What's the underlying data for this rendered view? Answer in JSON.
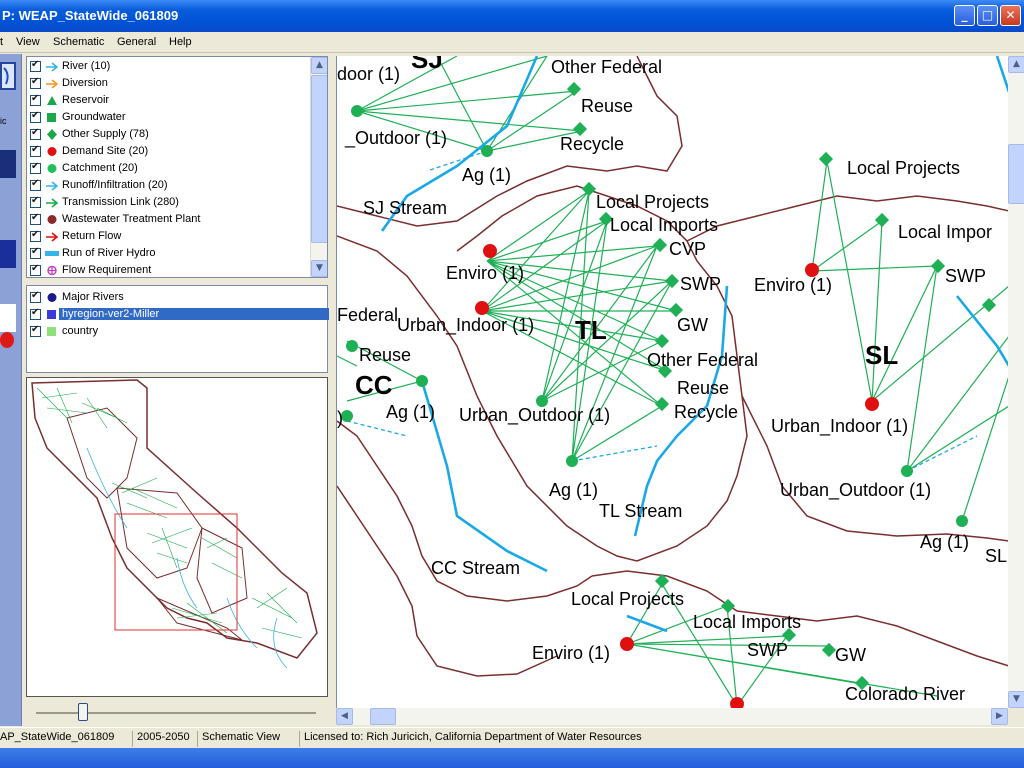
{
  "window": {
    "title": "P: WEAP_StateWide_061809",
    "buttons": {
      "minimize": "_",
      "maximize": "□",
      "close": "✕"
    }
  },
  "menu": [
    "t",
    "View",
    "Schematic",
    "General",
    "Help"
  ],
  "left_strip": {
    "label": "ic"
  },
  "legend": {
    "items": [
      {
        "label": "River (10)",
        "symbol": "river-arrow-icon",
        "color": "#33b5e8"
      },
      {
        "label": "Diversion",
        "symbol": "diversion-arrow-icon",
        "color": "#f39a1e"
      },
      {
        "label": "Reservoir",
        "symbol": "reservoir-triangle-icon",
        "color": "#1aa84a"
      },
      {
        "label": "Groundwater",
        "symbol": "groundwater-square-icon",
        "color": "#1aa84a"
      },
      {
        "label": "Other Supply (78)",
        "symbol": "other-supply-diamond-icon",
        "color": "#1aa84a"
      },
      {
        "label": "Demand Site (20)",
        "symbol": "demand-site-dot-icon",
        "color": "#e01010"
      },
      {
        "label": "Catchment (20)",
        "symbol": "catchment-dot-icon",
        "color": "#22c05a"
      },
      {
        "label": "Runoff/Infiltration (20)",
        "symbol": "runoff-arrow-icon",
        "color": "#33b5e8"
      },
      {
        "label": "Transmission Link (280)",
        "symbol": "transmission-arrow-icon",
        "color": "#1aa84a"
      },
      {
        "label": "Wastewater Treatment Plant",
        "symbol": "wastewater-dot-icon",
        "color": "#8b2a2a"
      },
      {
        "label": "Return Flow",
        "symbol": "return-flow-arrow-icon",
        "color": "#e01010"
      },
      {
        "label": "Run of River Hydro",
        "symbol": "run-of-river-bar-icon",
        "color": "#33b5e8"
      },
      {
        "label": "Flow Requirement",
        "symbol": "flow-requirement-icon",
        "color": "#c040c0"
      }
    ]
  },
  "layers": {
    "items": [
      {
        "label": "Major Rivers",
        "symbol": "major-rivers-dot-icon",
        "color": "#1a1a8c"
      },
      {
        "label": "hyregion-ver2-Miller",
        "symbol": "hyregion-square-icon",
        "color": "#3b3bd8",
        "selected": true
      },
      {
        "label": "country",
        "symbol": "country-square-icon",
        "color": "#8fe07a"
      }
    ]
  },
  "map": {
    "regions": [
      "SJ",
      "TL",
      "SL",
      "CC"
    ],
    "labels": {
      "door": "door (1)",
      "other_federal_top": "Other Federal",
      "reuse_top": "Reuse",
      "outdoor_top": "_Outdoor (1)",
      "recycle_top": "Recycle",
      "ag_top": "Ag (1)",
      "sj_stream": "SJ Stream",
      "local_projects_tl": "Local Projects",
      "local_imports_tl": "Local Imports",
      "cvp": "CVP",
      "enviro_tl": "Enviro (1)",
      "swp_tl": "SWP",
      "federal_left": "Federal",
      "urban_indoor_tl": "Urban_Indoor (1)",
      "gw_tl": "GW",
      "other_federal_tl": "Other Federal",
      "reuse_left": "Reuse",
      "reuse_tl": "Reuse",
      "ag_cc": "Ag (1)",
      "urban_outdoor_tl": "Urban_Outdoor (1)",
      "recycle_tl": "Recycle",
      "ag_tl": "Ag (1)",
      "tl_stream": "TL Stream",
      "cc_stream": "CC Stream",
      "local_projects_sl": "Local Projects",
      "local_impor_sl": "Local Impor",
      "enviro_sl": "Enviro (1)",
      "swp_sl": "SWP",
      "urban_indoor_sl": "Urban_Indoor (1)",
      "urban_outdoor_sl": "Urban_Outdoor (1)",
      "ag_sl": "Ag (1)",
      "sl_small": "SL",
      "local_projects_bottom": "Local Projects",
      "local_imports_bottom": "Local Imports",
      "enviro_bottom": "Enviro (1)",
      "swp_bottom": "SWP",
      "gw_bottom": "GW",
      "colorado_river": "Colorado River",
      "paren": ")"
    }
  },
  "status": {
    "area": "AP_StateWide_061809",
    "years": "2005-2050",
    "view": "Schematic View",
    "license": "Licensed to: Rich Juricich, California Department of Water Resources"
  },
  "colors": {
    "link": "#1aa84a",
    "river": "#1aa8e8",
    "boundary": "#7a2e2e",
    "demand": "#e01010"
  }
}
